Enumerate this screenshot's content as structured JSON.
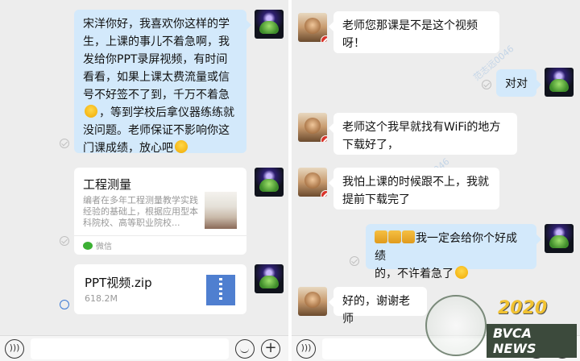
{
  "left_chat": {
    "message1": {
      "line1": "宋洋你好，我喜欢你这样的学",
      "line2": "生，上课的事儿不着急啊，我",
      "line3": "发给你PPT录屏视频，有时间",
      "line4": "看看，如果上课太费流量或信",
      "line5": "号不好签不了到，千万不着急",
      "line6": "，等到学校后拿仪器练练就",
      "line7": "没问题。老师保证不影响你这",
      "line8": "门课成绩，放心吧"
    },
    "article_card": {
      "title": "工程测量",
      "description": "编者在多年工程测量教学实践经验的基础上，根据应用型本科院校、高等职业院校...",
      "source": "微信"
    },
    "file_card": {
      "name": "PPT视频.zip",
      "size": "618.2M"
    }
  },
  "right_chat": {
    "messages": [
      {
        "line1": "老师您那课是不是这个视频",
        "line2": "呀！"
      },
      {
        "line1": "对对"
      },
      {
        "line1": "老师这个我早就找有WiFi的地方",
        "line2": "下载好了，"
      },
      {
        "line1": "我怕上课的时候跟不上，我就",
        "line2": "提前下载完了"
      },
      {
        "line1": "我一定会给你个好成绩",
        "line2": "的，不许着急了"
      },
      {
        "line1": "好的，谢谢老师"
      }
    ]
  },
  "watermark_text": "范志远0046",
  "logo": {
    "year": "2020",
    "name": "BVCA NEWS"
  },
  "icons": [
    "voice-icon",
    "emoji-icon",
    "plus-icon",
    "zip-file-icon",
    "wechat-icon",
    "read-check-icon"
  ],
  "colors": {
    "blue_bubble": "#d3e9fb",
    "white_bubble": "#ffffff",
    "background": "#ededed",
    "zip_blue": "#4f7fd0"
  }
}
